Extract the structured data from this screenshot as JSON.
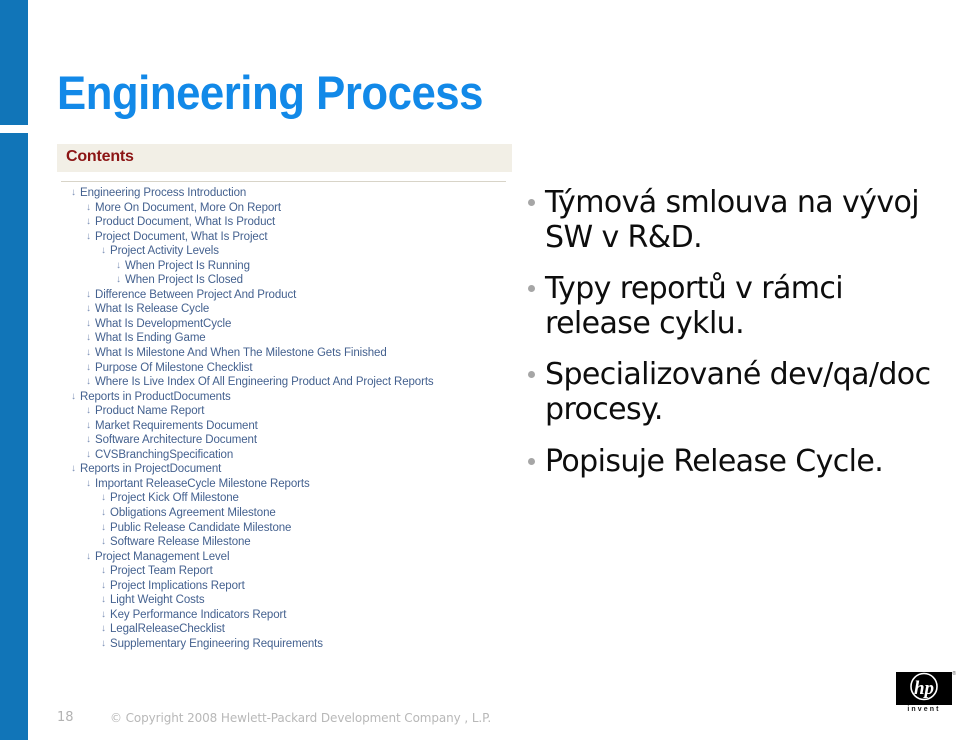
{
  "slide": {
    "title": "Engineering Process",
    "accent_color": "#1175b8",
    "title_color": "#1289e8"
  },
  "toc_panel": {
    "header": "Contents",
    "header_color": "#8c1515",
    "band_color": "#f2efe6",
    "link_color": "#44618f",
    "arrow_glyph": "↓",
    "items": [
      {
        "level": 1,
        "label": "Engineering Process Introduction"
      },
      {
        "level": 2,
        "label": "More On Document, More On Report"
      },
      {
        "level": 2,
        "label": "Product Document, What Is Product"
      },
      {
        "level": 2,
        "label": "Project Document, What Is Project"
      },
      {
        "level": 3,
        "label": "Project Activity Levels"
      },
      {
        "level": 4,
        "label": "When Project Is Running"
      },
      {
        "level": 4,
        "label": "When Project Is Closed"
      },
      {
        "level": 2,
        "label": "Difference Between Project And Product"
      },
      {
        "level": 2,
        "label": "What Is Release Cycle"
      },
      {
        "level": 2,
        "label": "What Is DevelopmentCycle"
      },
      {
        "level": 2,
        "label": "What Is Ending Game"
      },
      {
        "level": 2,
        "label": "What Is Milestone And When The Milestone Gets Finished"
      },
      {
        "level": 2,
        "label": "Purpose Of Milestone Checklist"
      },
      {
        "level": 2,
        "label": "Where Is Live Index Of All Engineering Product And Project Reports"
      },
      {
        "level": 1,
        "label": "Reports in ProductDocuments"
      },
      {
        "level": 2,
        "label": "Product Name Report"
      },
      {
        "level": 2,
        "label": "Market Requirements Document"
      },
      {
        "level": 2,
        "label": "Software Architecture Document"
      },
      {
        "level": 2,
        "label": "CVSBranchingSpecification"
      },
      {
        "level": 1,
        "label": "Reports in ProjectDocument"
      },
      {
        "level": 2,
        "label": "Important ReleaseCycle Milestone Reports"
      },
      {
        "level": 3,
        "label": "Project Kick Off Milestone"
      },
      {
        "level": 3,
        "label": "Obligations Agreement Milestone"
      },
      {
        "level": 3,
        "label": "Public Release Candidate Milestone"
      },
      {
        "level": 3,
        "label": "Software Release Milestone"
      },
      {
        "level": 2,
        "label": "Project Management Level"
      },
      {
        "level": 3,
        "label": "Project Team Report"
      },
      {
        "level": 3,
        "label": "Project Implications Report"
      },
      {
        "level": 3,
        "label": "Light Weight Costs"
      },
      {
        "level": 3,
        "label": "Key Performance Indicators Report"
      },
      {
        "level": 3,
        "label": "LegalReleaseChecklist"
      },
      {
        "level": 3,
        "label": "Supplementary Engineering Requirements"
      }
    ]
  },
  "bullets": [
    "Týmová smlouva na vývoj SW v R&D.",
    "Typy reportů v rámci release cyklu.",
    "Specializované dev/qa/doc procesy.",
    "Popisuje Release Cycle."
  ],
  "footer": {
    "page_number": "18",
    "copyright": "© Copyright 2008 Hewlett-Packard  Development Company , L.P."
  },
  "logo": {
    "brand": "hp",
    "tagline": "invent",
    "registered_mark": "®"
  }
}
